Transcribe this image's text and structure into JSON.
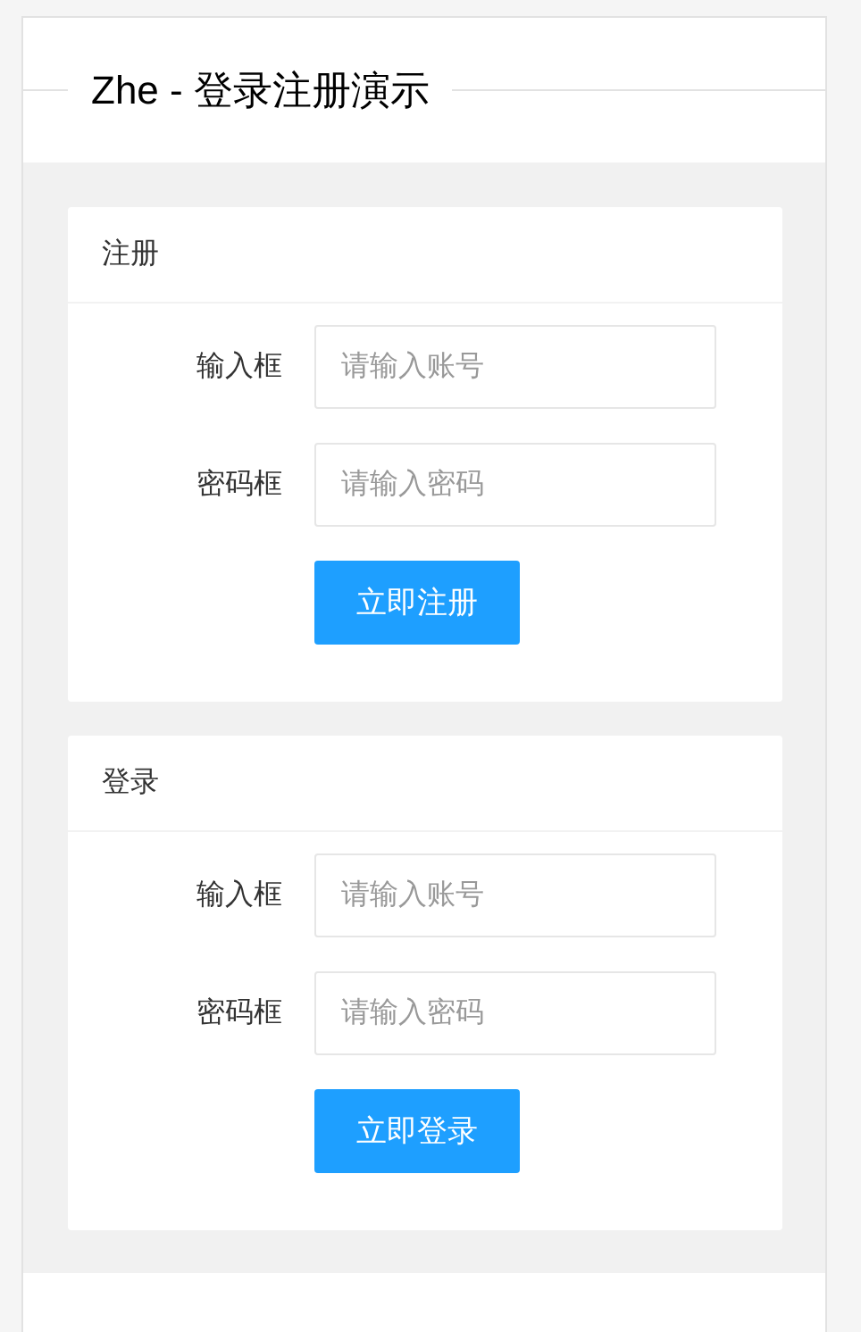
{
  "header": {
    "title": "Zhe - 登录注册演示"
  },
  "forms": [
    {
      "title": "注册",
      "fields": [
        {
          "label": "输入框",
          "placeholder": "请输入账号"
        },
        {
          "label": "密码框",
          "placeholder": "请输入密码"
        }
      ],
      "button": "立即注册"
    },
    {
      "title": "登录",
      "fields": [
        {
          "label": "输入框",
          "placeholder": "请输入账号"
        },
        {
          "label": "密码框",
          "placeholder": "请输入密码"
        }
      ],
      "button": "立即登录"
    }
  ]
}
